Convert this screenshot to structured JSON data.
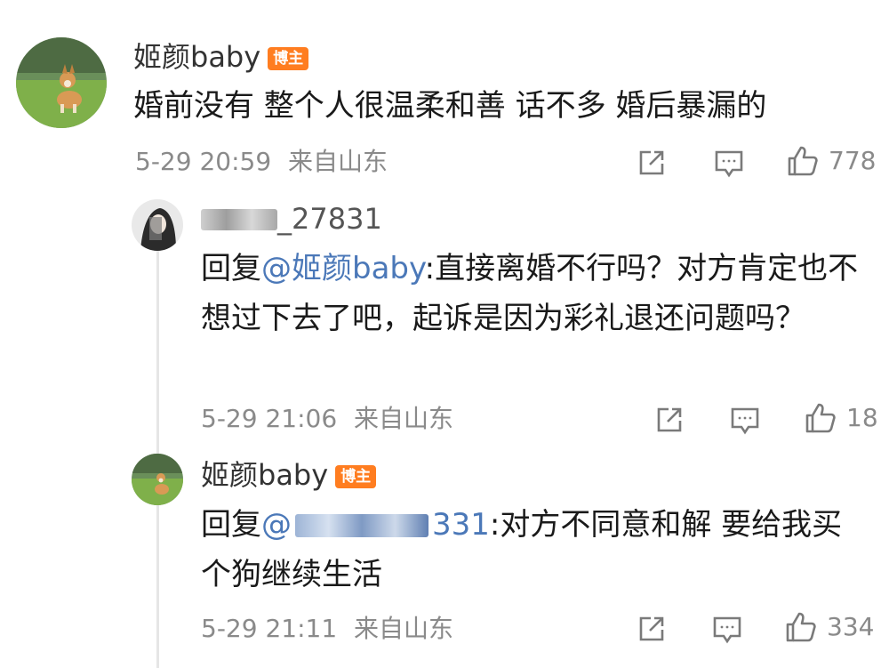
{
  "comments": [
    {
      "author": "姬颜baby",
      "badge": "博主",
      "text": "婚前没有 整个人很温柔和善 话不多 婚后暴漏的",
      "timestamp": "5-29 20:59",
      "location": "来自山东",
      "likes": "778"
    }
  ],
  "replies": [
    {
      "author_visible": "_27831",
      "reply_prefix": "回复",
      "mention": "@姬颜baby",
      "text": ":直接离婚不行吗？对方肯定也不想过下去了吧，起诉是因为彩礼退还问题吗？",
      "timestamp": "5-29 21:06",
      "location": "来自山东",
      "likes": "18"
    },
    {
      "author": "姬颜baby",
      "badge": "博主",
      "reply_prefix": "回复",
      "mention_prefix": "@",
      "mention_suffix": "331",
      "text": ":对方不同意和解 要给我买个狗继续生活",
      "timestamp": "5-29 21:11",
      "location": "来自山东",
      "likes": "334"
    }
  ],
  "icons": [
    "share-icon",
    "comment-icon",
    "like-icon"
  ],
  "colors": {
    "mention": "#4b78b8",
    "badge": "#ff7d20",
    "meta": "#8a8a8a"
  }
}
